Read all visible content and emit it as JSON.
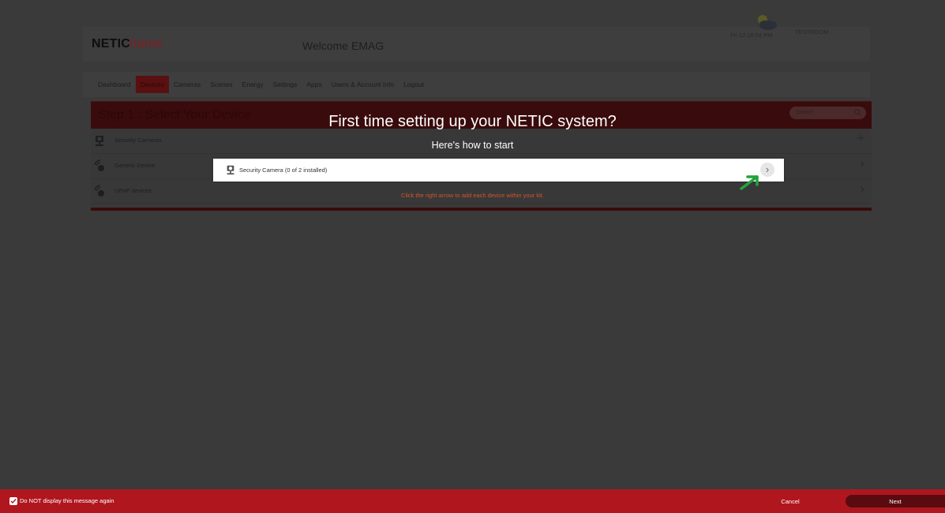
{
  "app": {
    "logo_part1": "NETIC",
    "logo_part2": "home",
    "welcome": "Welcome EMAG"
  },
  "weather": {
    "temperature": "5°C",
    "icon": "partly-cloudy-icon",
    "datetime": "Fri  12:16:54 PM",
    "user": "TESTROOM"
  },
  "nav": {
    "items": [
      "Dashboard",
      "Devices",
      "Cameras",
      "Scenes",
      "Energy",
      "Settings",
      "Apps",
      "Users & Account Info",
      "Logout"
    ],
    "active": "Devices"
  },
  "step": {
    "title": "Step 1 : Select Your Device",
    "search_placeholder": "Search"
  },
  "devices": [
    {
      "label": "Security Cameras",
      "icon": "camera-icon",
      "action": "+"
    },
    {
      "label": "Generic Device",
      "icon": "generic-device-icon",
      "action": "›"
    },
    {
      "label": "UPnP devices",
      "icon": "upnp-device-icon",
      "action": "›"
    }
  ],
  "overlay": {
    "title": "First time setting up your NETIC system?",
    "subtitle": "Here's how to start",
    "highlight_label": "Security Camera (0 of 2 installed)",
    "hint": "Click the right arrow to add each device within your kit."
  },
  "footer": {
    "checkbox_label": "Do NOT display this message again",
    "checkbox_checked": true,
    "cancel_label": "Cancel",
    "next_label": "Next"
  },
  "colors": {
    "brand_red": "#b0161e",
    "hint_orange": "#d3542c",
    "arrow_green": "#22a33a"
  }
}
